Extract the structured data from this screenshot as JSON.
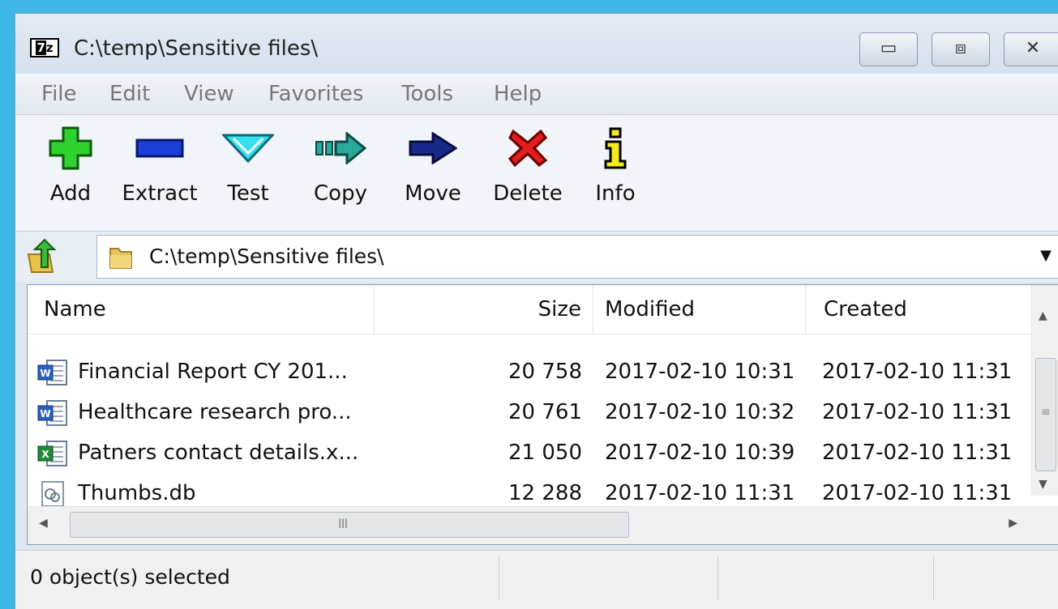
{
  "window": {
    "app_icon_text": "7z",
    "title": "C:\\temp\\Sensitive files\\"
  },
  "menu": [
    "File",
    "Edit",
    "View",
    "Favorites",
    "Tools",
    "Help"
  ],
  "toolbar": {
    "add": "Add",
    "extract": "Extract",
    "test": "Test",
    "copy": "Copy",
    "move": "Move",
    "delete": "Delete",
    "info": "Info"
  },
  "address": {
    "path": "C:\\temp\\Sensitive files\\"
  },
  "list": {
    "columns": {
      "name": "Name",
      "size": "Size",
      "modified": "Modified",
      "created": "Created"
    },
    "rows": [
      {
        "icon": "word-doc-icon",
        "name": "Financial Report CY 201...",
        "size": "20 758",
        "modified": "2017-02-10 10:31",
        "created": "2017-02-10 11:31"
      },
      {
        "icon": "word-doc-icon",
        "name": "Healthcare research pro...",
        "size": "20 761",
        "modified": "2017-02-10 10:32",
        "created": "2017-02-10 11:31"
      },
      {
        "icon": "excel-doc-icon",
        "name": "Patners contact details.x...",
        "size": "21 050",
        "modified": "2017-02-10 10:39",
        "created": "2017-02-10 11:31"
      },
      {
        "icon": "db-file-icon",
        "name": "Thumbs.db",
        "size": "12 288",
        "modified": "2017-02-10 11:31",
        "created": "2017-02-10 11:31"
      }
    ]
  },
  "status": {
    "selected": "0 object(s) selected"
  }
}
